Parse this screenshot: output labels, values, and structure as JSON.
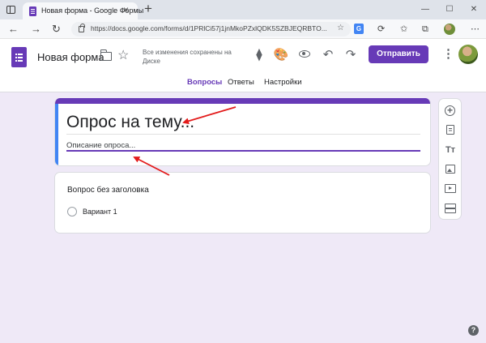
{
  "browser": {
    "tab_title": "Новая форма - Google Формы",
    "tab_close": "×",
    "new_tab": "+",
    "url": "https://docs.google.com/forms/d/1PRlCi57j1jnMkoPZxlQDK5SZBJEQRBTO...",
    "window_controls": {
      "minimize": "—",
      "maximize": "☐",
      "close": "✕"
    }
  },
  "header": {
    "doc_title": "Новая форма",
    "save_status": "Все изменения сохранены на Диске",
    "send_label": "Отправить",
    "more": "⋮"
  },
  "tabs": [
    {
      "label": "Вопросы",
      "active": true
    },
    {
      "label": "Ответы",
      "active": false
    },
    {
      "label": "Настройки",
      "active": false
    }
  ],
  "form": {
    "title": "Опрос на тему...",
    "description": "Описание опроса..."
  },
  "question": {
    "title": "Вопрос без заголовка",
    "option": "Вариант 1"
  },
  "side_tools": {
    "add": "+",
    "text": "Tт"
  },
  "help": "?",
  "colors": {
    "accent": "#673ab7",
    "background": "#efe9f7",
    "arrow": "#e31b1b"
  }
}
